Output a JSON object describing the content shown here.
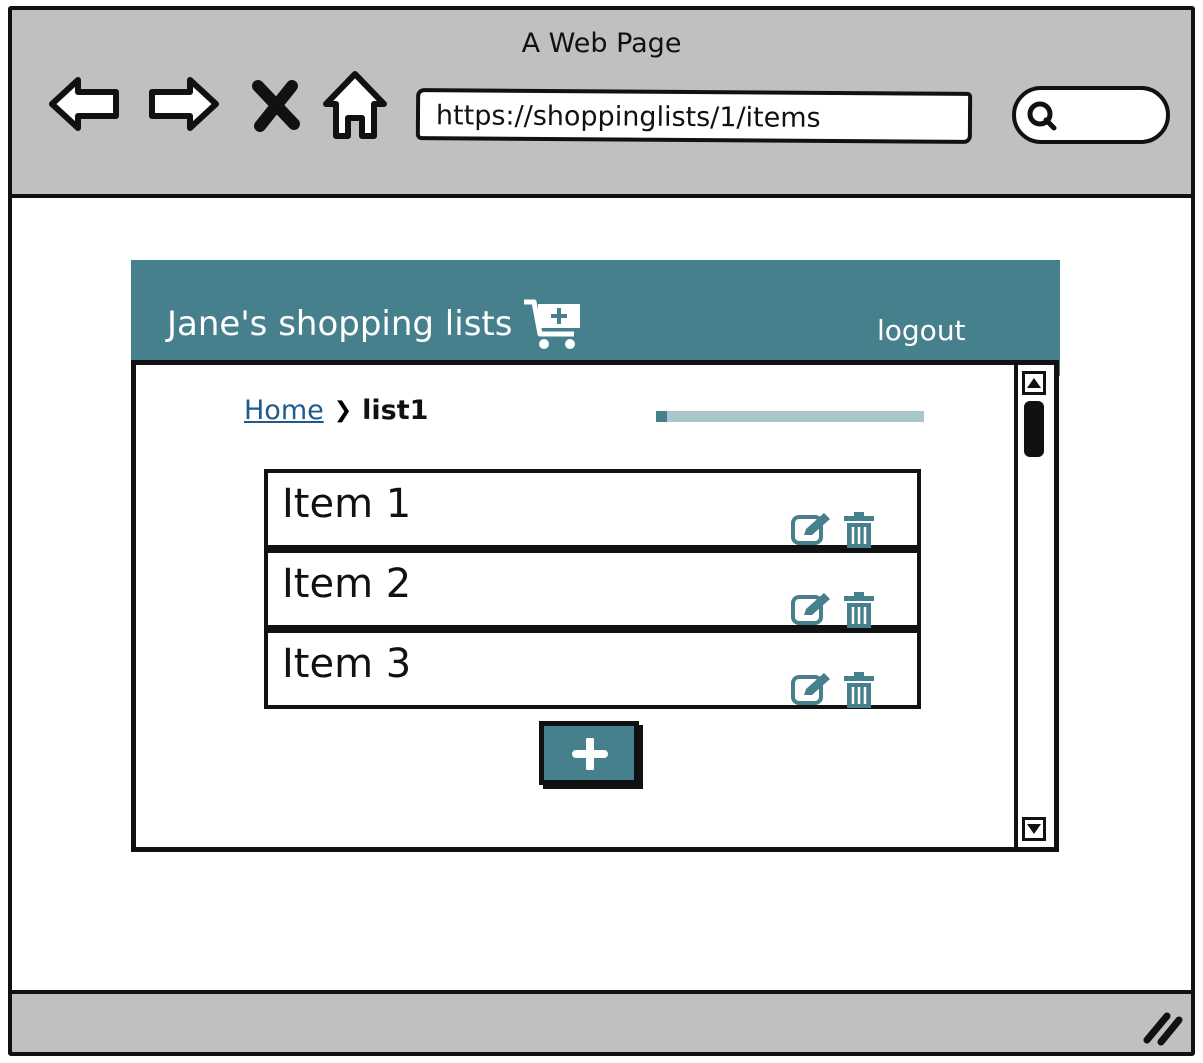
{
  "browser": {
    "window_title": "A Web Page",
    "url": "https://shoppinglists/1/items"
  },
  "app": {
    "brand_title": "Jane's shopping lists",
    "logout_label": "logout",
    "accent_color": "#47808d"
  },
  "breadcrumb": {
    "home_label": "Home",
    "current_label": "list1"
  },
  "progress": {
    "fraction": 0.04
  },
  "items": [
    {
      "label": "Item 1"
    },
    {
      "label": "Item 2"
    },
    {
      "label": "Item 3"
    }
  ],
  "icons": {
    "back": "back-arrow-icon",
    "forward": "forward-arrow-icon",
    "stop": "close-icon",
    "home": "home-icon",
    "search": "search-icon",
    "cart": "cart-add-icon",
    "edit": "edit-icon",
    "delete": "trash-icon",
    "add": "plus-icon"
  }
}
